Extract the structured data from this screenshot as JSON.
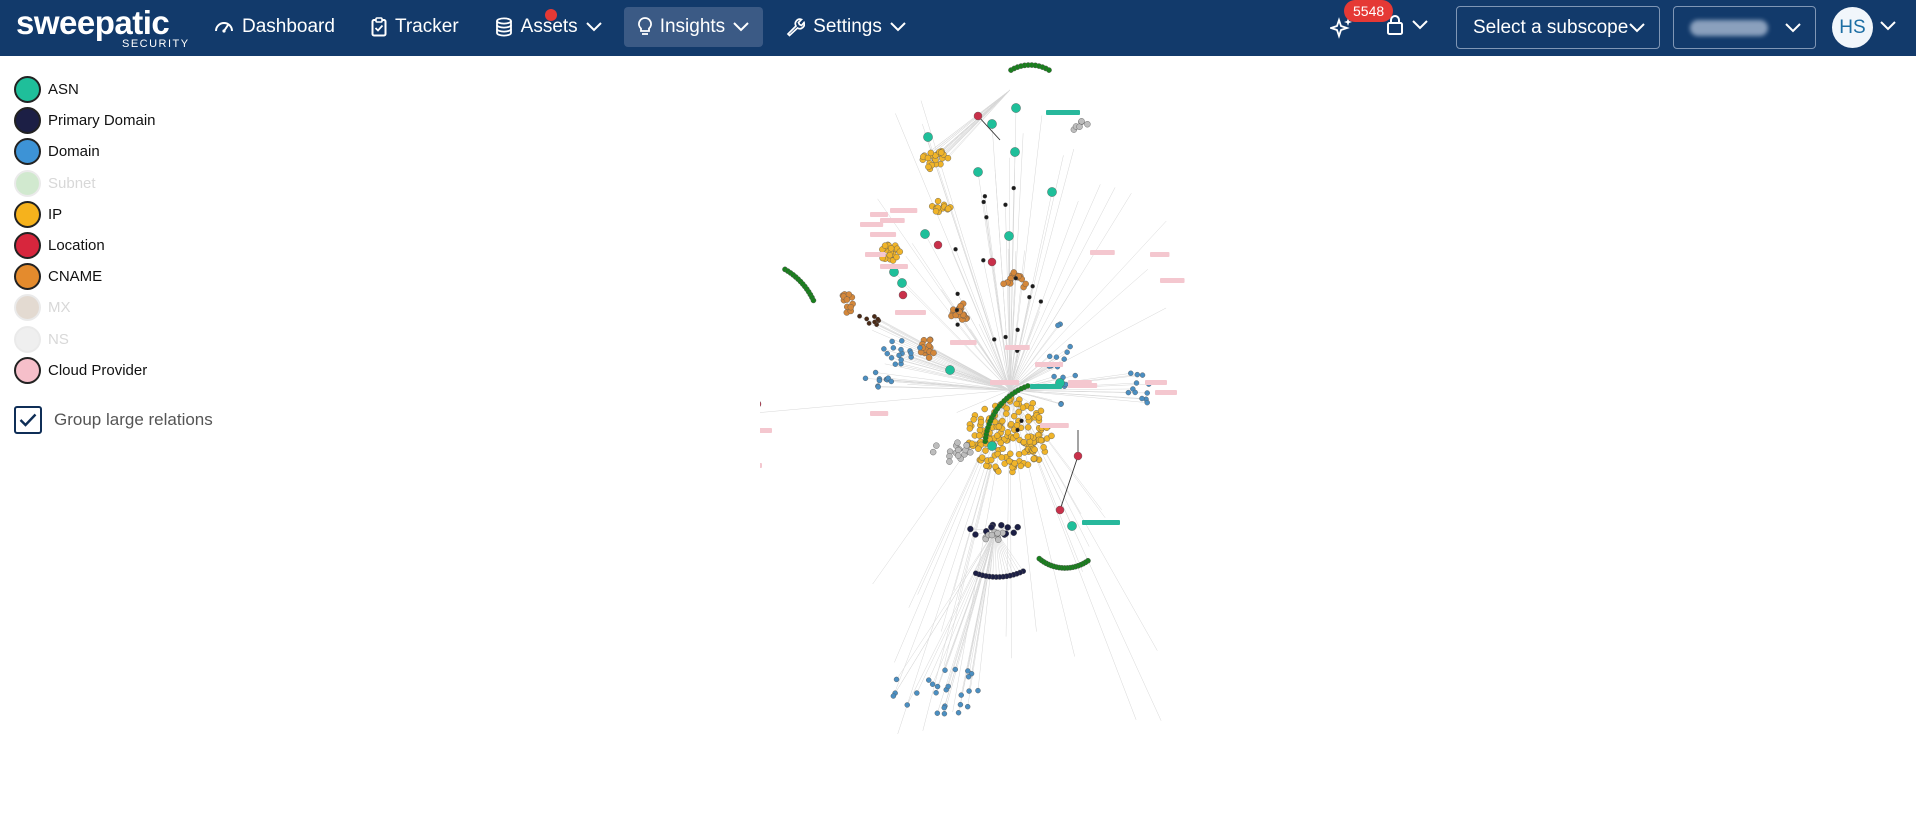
{
  "app": {
    "logo_main": "sweepatic",
    "logo_sub": "SECURITY"
  },
  "nav": {
    "items": [
      {
        "label": "Dashboard",
        "icon": "gauge-icon"
      },
      {
        "label": "Tracker",
        "icon": "clipboard-icon"
      },
      {
        "label": "Assets",
        "icon": "database-icon"
      },
      {
        "label": "Insights",
        "icon": "lightbulb-icon",
        "active": true
      },
      {
        "label": "Settings",
        "icon": "wrench-icon"
      }
    ]
  },
  "header": {
    "notification_count": "5548",
    "subscope_placeholder": "Select a subscope",
    "avatar_initials": "HS"
  },
  "legend": {
    "items": [
      {
        "label": "ASN",
        "color": "#1fbf9a",
        "enabled": true
      },
      {
        "label": "Primary Domain",
        "color": "#1c1f45",
        "enabled": true
      },
      {
        "label": "Domain",
        "color": "#3d93d6",
        "enabled": true
      },
      {
        "label": "Subnet",
        "color": "#b4dcb0",
        "enabled": false
      },
      {
        "label": "IP",
        "color": "#f6b21c",
        "enabled": true
      },
      {
        "label": "Location",
        "color": "#d7263d",
        "enabled": true
      },
      {
        "label": "CNAME",
        "color": "#e48b2d",
        "enabled": true
      },
      {
        "label": "MX",
        "color": "#d2c2b4",
        "enabled": false
      },
      {
        "label": "NS",
        "color": "#e5e5e5",
        "enabled": false
      },
      {
        "label": "Cloud Provider",
        "color": "#f6bfca",
        "enabled": true
      }
    ],
    "group_large_relations_label": "Group large relations",
    "group_large_relations_checked": true
  },
  "graph": {
    "colors": {
      "asn": "#1fbf9a",
      "primary": "#1c1f45",
      "domain": "#4b8fc2",
      "ip": "#f0b429",
      "location": "#c9304a",
      "cname": "#d4873a",
      "green": "#18801c",
      "grey": "#bdbdbd",
      "pink_label": "#f4c7cf",
      "edge": "#d7d7d7",
      "tag": "#28b89c"
    }
  }
}
